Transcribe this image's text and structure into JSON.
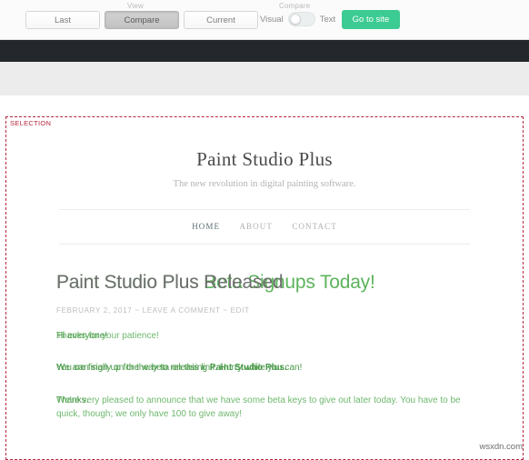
{
  "toolbar": {
    "view_group_label": "View",
    "compare_group_label": "Compare",
    "buttons": [
      {
        "label": "Last",
        "active": false
      },
      {
        "label": "Compare",
        "active": true
      },
      {
        "label": "Current",
        "active": false
      }
    ],
    "toggle": {
      "left_label": "Visual",
      "right_label": "Text",
      "position": "left"
    },
    "goto_site_label": "Go to site",
    "accent_color": "#3ccb92"
  },
  "selection": {
    "tag": "SELECTION",
    "border_color": "#b5273f"
  },
  "site": {
    "title": "Paint Studio Plus",
    "tagline": "The new revolution in digital painting software.",
    "nav": [
      {
        "label": "HOME",
        "active": true
      },
      {
        "label": "ABOUT",
        "active": false
      },
      {
        "label": "CONTACT",
        "active": false
      }
    ]
  },
  "post": {
    "headline_old": "Paint Studio Plus Released",
    "headline_new": "Paint Studio Plus Beta Signups Today!",
    "meta": "FEBRUARY 2, 2017 ~ LEAVE A COMMENT ~ EDIT",
    "meta_parts": {
      "date": "FEBRUARY 2, 2017",
      "separator": "~",
      "comment": "LEAVE A COMMENT",
      "edit": "EDIT"
    },
    "paragraph1_old": "Hi everyone!",
    "paragraph1_new": "Thanks for your patience!",
    "paragraph2_old": "You can sign up for the beta on this link. Hurry while you can!",
    "paragraph2_new_prefix": "We are finally on the way to releasing ",
    "paragraph2_new_bold": "Paint Studio Plus.",
    "paragraph3_old": "Thanks.",
    "paragraph3_new": "We're very pleased to announce that we have some beta keys to give out later today. You have to be quick, though; we only have 100 to give away!",
    "old_color": "#6f6f6f",
    "new_color": "#5cb45c"
  },
  "watermark": "wsxdn.com"
}
